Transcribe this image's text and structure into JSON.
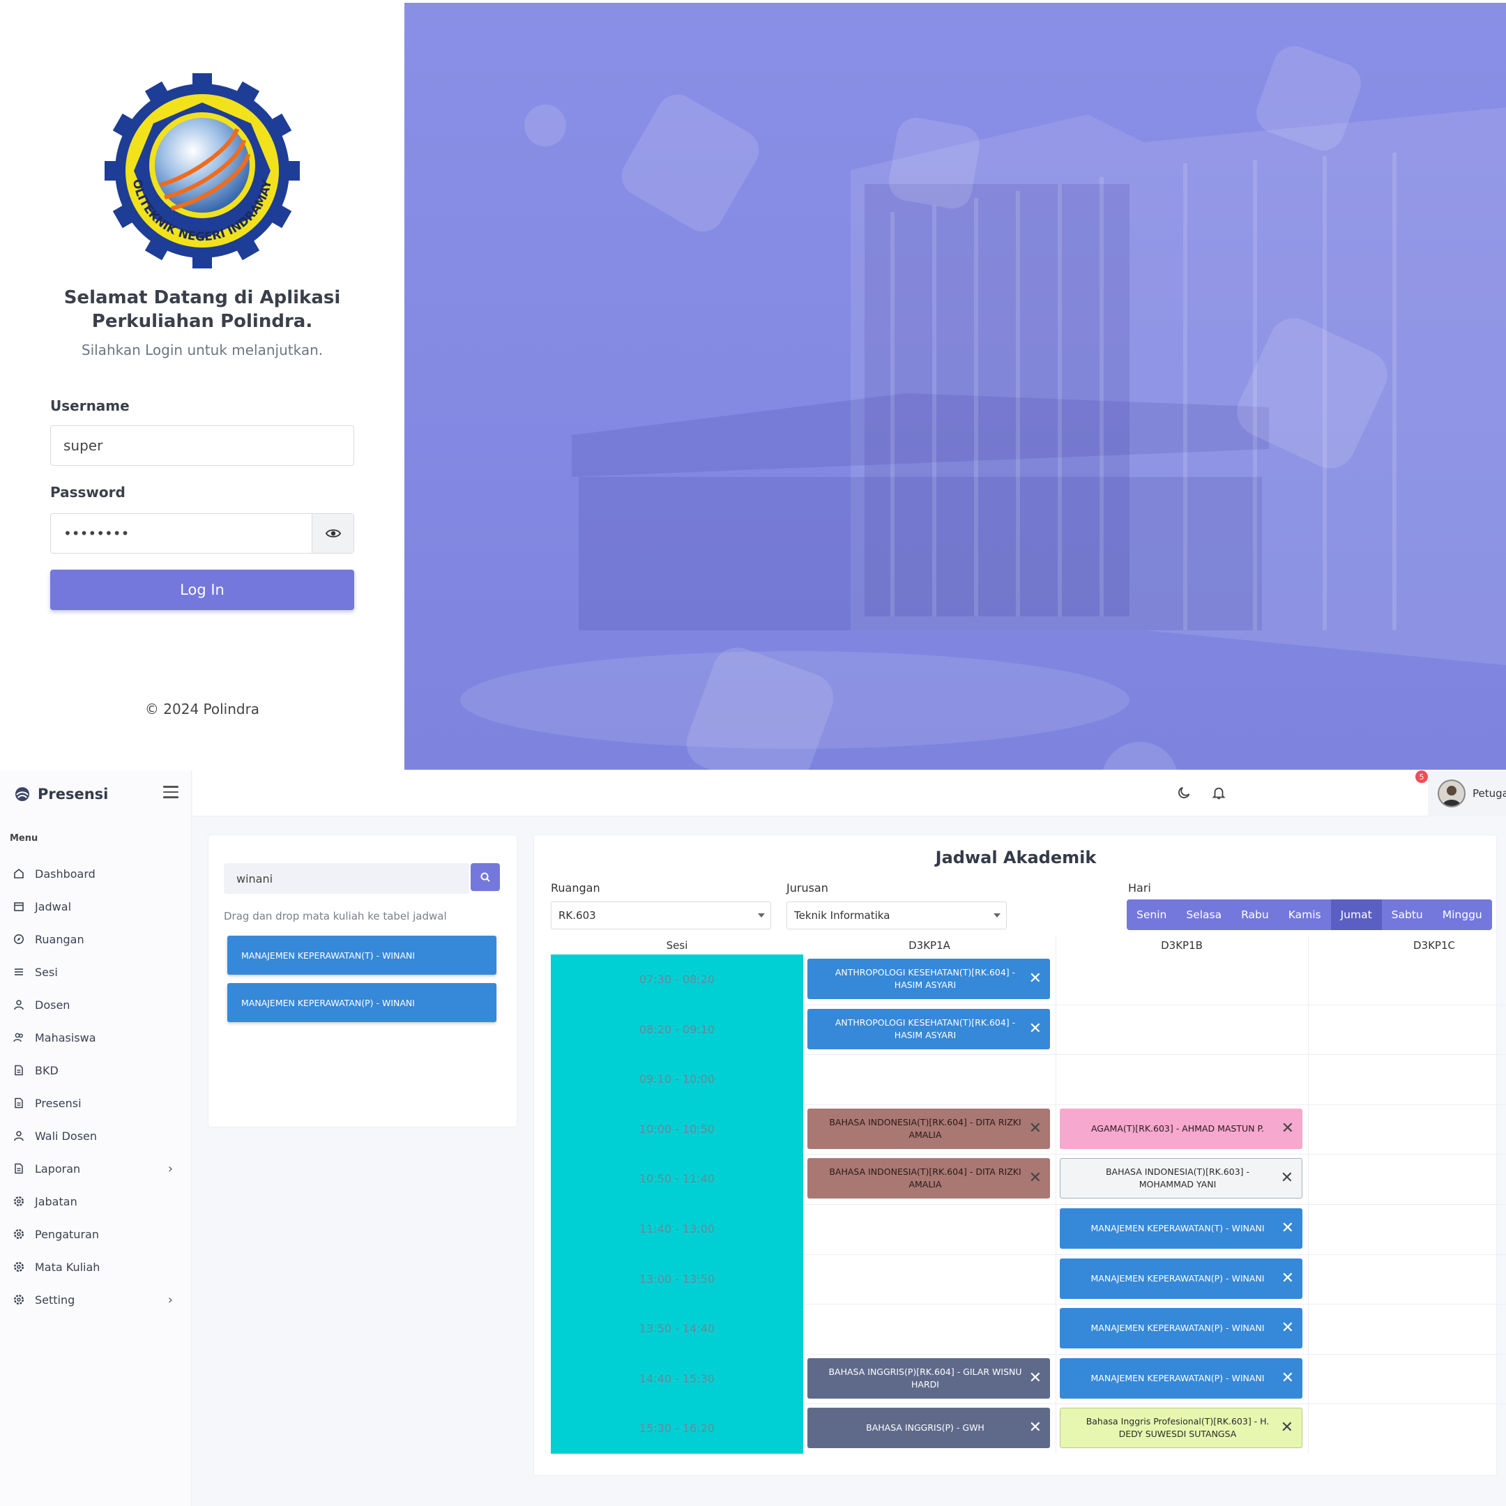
{
  "login": {
    "welcome_line1": "Selamat Datang di Aplikasi",
    "welcome_line2": "Perkuliahan Polindra.",
    "subtitle": "Silahkan Login untuk melanjutkan.",
    "username_label": "Username",
    "username_value": "super",
    "password_label": "Password",
    "password_value": "••••••••",
    "login_button": "Log In",
    "copyright": "© 2024 Polindra",
    "logo_text": "POLITEKNIK NEGERI INDRAMAYU"
  },
  "app": {
    "brand": "Presensi",
    "menu_heading": "Menu",
    "nav": [
      {
        "label": "Dashboard",
        "icon": "home-icon"
      },
      {
        "label": "Jadwal",
        "icon": "calendar-icon"
      },
      {
        "label": "Ruangan",
        "icon": "compass-icon"
      },
      {
        "label": "Sesi",
        "icon": "list-icon"
      },
      {
        "label": "Dosen",
        "icon": "user-icon"
      },
      {
        "label": "Mahasiswa",
        "icon": "users-icon"
      },
      {
        "label": "BKD",
        "icon": "document-icon"
      },
      {
        "label": "Presensi",
        "icon": "document-icon"
      },
      {
        "label": "Wali Dosen",
        "icon": "user-icon"
      },
      {
        "label": "Laporan",
        "icon": "document-icon",
        "has_children": true
      },
      {
        "label": "Jabatan",
        "icon": "gear-icon"
      },
      {
        "label": "Pengaturan",
        "icon": "gear-icon"
      },
      {
        "label": "Mata Kuliah",
        "icon": "gear-icon"
      },
      {
        "label": "Setting",
        "icon": "gear-icon",
        "has_children": true
      }
    ],
    "notification_count": "5",
    "user_name": "Petugas Administrator dan Basis Data"
  },
  "search": {
    "value": "winani",
    "hint": "Drag dan drop mata kuliah ke tabel jadwal",
    "results": [
      "MANAJEMEN KEPERAWATAN(T) - WINANI",
      "MANAJEMEN KEPERAWATAN(P) - WINANI"
    ]
  },
  "schedule": {
    "title": "Jadwal Akademik",
    "ruangan_label": "Ruangan",
    "ruangan_value": "RK.603",
    "jurusan_label": "Jurusan",
    "jurusan_value": "Teknik Informatika",
    "hari_label": "Hari",
    "days": [
      "Senin",
      "Selasa",
      "Rabu",
      "Kamis",
      "Jumat",
      "Sabtu",
      "Minggu"
    ],
    "active_day": "Jumat",
    "columns": [
      "Sesi",
      "D3KP1A",
      "D3KP1B",
      "D3KP1C"
    ],
    "sessions": [
      "07:30 - 08:20",
      "08:20 - 09:10",
      "09:10 - 10:00",
      "10:00 - 10:50",
      "10:50 - 11:40",
      "11:40 - 13:00",
      "13:00 - 13:50",
      "13:50 - 14:40",
      "14:40 - 15:30",
      "15:30 - 16:20"
    ],
    "entries": [
      {
        "row": 0,
        "col": 0,
        "text": "ANTHROPOLOGI KESEHATAN(T)[RK.604] - HASIM ASYARI",
        "color": "blue"
      },
      {
        "row": 1,
        "col": 0,
        "text": "ANTHROPOLOGI KESEHATAN(T)[RK.604] - HASIM ASYARI",
        "color": "blue"
      },
      {
        "row": 3,
        "col": 0,
        "text": "BAHASA INDONESIA(T)[RK.604] - DITA RIZKI AMALIA",
        "color": "brown"
      },
      {
        "row": 4,
        "col": 0,
        "text": "BAHASA INDONESIA(T)[RK.604] - DITA RIZKI AMALIA",
        "color": "brown"
      },
      {
        "row": 8,
        "col": 0,
        "text": "BAHASA INGGRIS(P)[RK.604] - GILAR WISNU HARDI",
        "color": "slate"
      },
      {
        "row": 9,
        "col": 0,
        "text": "BAHASA INGGRIS(P) - GWH",
        "color": "slate"
      },
      {
        "row": 3,
        "col": 1,
        "text": "AGAMA(T)[RK.603] - AHMAD MASTUN P.",
        "color": "pink"
      },
      {
        "row": 4,
        "col": 1,
        "text": "BAHASA INDONESIA(T)[RK.603] - MOHAMMAD YANI",
        "color": "white"
      },
      {
        "row": 5,
        "col": 1,
        "text": "MANAJEMEN KEPERAWATAN(T) - WINANI",
        "color": "blue"
      },
      {
        "row": 6,
        "col": 1,
        "text": "MANAJEMEN KEPERAWATAN(P) - WINANI",
        "color": "blue"
      },
      {
        "row": 7,
        "col": 1,
        "text": "MANAJEMEN KEPERAWATAN(P) - WINANI",
        "color": "blue"
      },
      {
        "row": 8,
        "col": 1,
        "text": "MANAJEMEN KEPERAWATAN(P) - WINANI",
        "color": "blue"
      },
      {
        "row": 9,
        "col": 1,
        "text": "Bahasa Inggris Profesional(T)[RK.603] - H. DEDY SUWESDI SUTANGSA",
        "color": "lime"
      }
    ],
    "remove_glyph": "✕"
  },
  "colors": {
    "accent": "#7478dc",
    "teal": "#00cfd4",
    "blue": "#3688d8"
  }
}
